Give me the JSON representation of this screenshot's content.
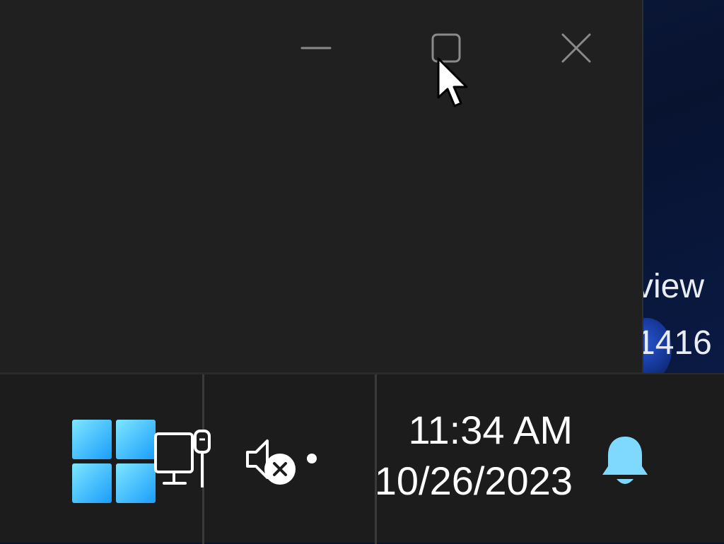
{
  "desktop": {
    "text_line1": "view",
    "text_line2": "1416"
  },
  "window": {
    "minimize_icon": "minimize-icon",
    "maximize_icon": "maximize-icon",
    "close_icon": "close-icon"
  },
  "taskbar": {
    "start_icon": "windows-logo-icon",
    "network_icon": "ethernet-network-icon",
    "volume_icon": "volume-muted-icon",
    "notification_icon": "bell-icon",
    "accent_color": "#5fd3ff"
  },
  "clock": {
    "time": "11:34 AM",
    "date": "10/26/2023"
  }
}
